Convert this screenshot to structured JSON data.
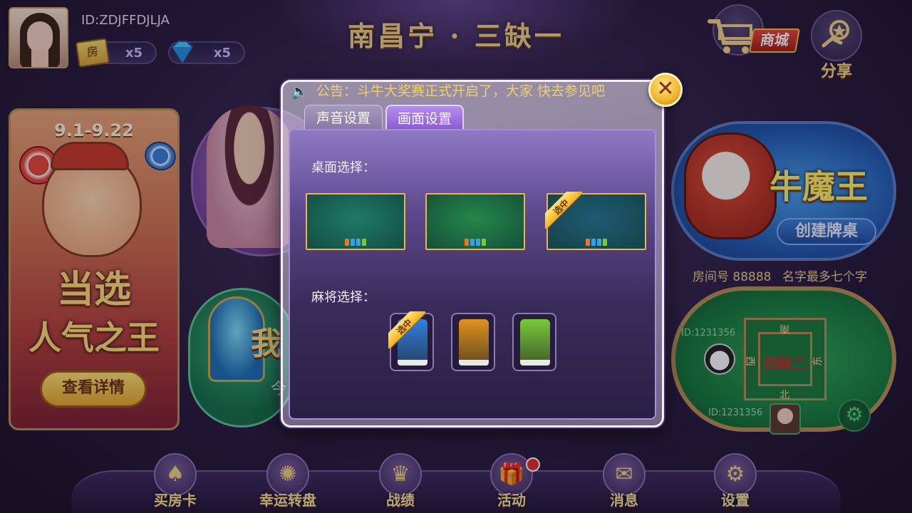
{
  "header": {
    "title": "南昌宁 · 三缺一",
    "user_id": "ID:ZDJFFDJLJA",
    "room_card_icon_text": "房",
    "room_card_count": "x5",
    "diamond_count": "x5",
    "shop_label": "商城",
    "share_label": "分享"
  },
  "announcement": {
    "text": "公告：斗牛大奖赛正式开启了，大家 快去参见吧"
  },
  "left_banner": {
    "date": "9.1-9.22",
    "line1": "当选",
    "line2": "人气之王",
    "button": "查看详情"
  },
  "middle": {
    "big_char": "我",
    "sub_char": "今"
  },
  "right_panel": {
    "cow_title": "牛魔王",
    "create_table": "创建牌桌",
    "room_number": "房间号 88888",
    "room_name": "名字最多七个字",
    "seat_id_1": "ID:1231356",
    "seat_id_2": "ID:1231356",
    "table_center": "四缺二",
    "pos_north": "北",
    "pos_south": "南",
    "pos_west": "西",
    "pos_east": "东"
  },
  "dialog": {
    "tabs": [
      {
        "label": "声音设置",
        "active": false
      },
      {
        "label": "画面设置",
        "active": true
      }
    ],
    "table_section_label": "桌面选择：",
    "tile_section_label": "麻将选择：",
    "selected_badge": "选中",
    "table_options": [
      {
        "color": "#1f7a68",
        "selected": false
      },
      {
        "color": "#25864a",
        "selected": false
      },
      {
        "color": "#1f5a74",
        "selected": true
      }
    ],
    "tile_options": [
      {
        "color": "#2f7fe0",
        "selected": true
      },
      {
        "color": "#e0921c",
        "selected": false
      },
      {
        "color": "#7ac83a",
        "selected": false
      }
    ]
  },
  "bottom_nav": [
    {
      "label": "买房卡",
      "icon": "card-icon"
    },
    {
      "label": "幸运转盘",
      "icon": "wheel-icon"
    },
    {
      "label": "战绩",
      "icon": "crown-icon"
    },
    {
      "label": "活动",
      "icon": "gift-icon"
    },
    {
      "label": "消息",
      "icon": "mail-icon"
    },
    {
      "label": "设置",
      "icon": "gear-icon"
    }
  ]
}
